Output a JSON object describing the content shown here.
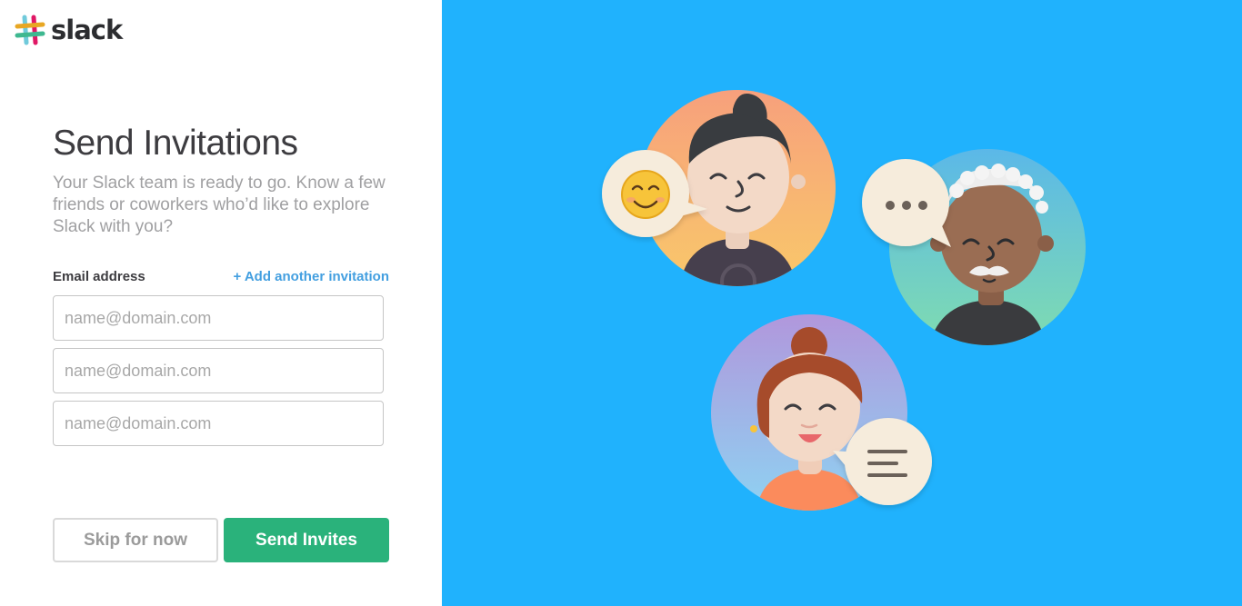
{
  "brand": {
    "name": "slack",
    "colors": {
      "green": "#2ab27b",
      "blue": "#439fe0",
      "panel": "#20b2fd"
    }
  },
  "form": {
    "title": "Send Invitations",
    "subtitle": "Your Slack team is ready to go. Know a few friends or coworkers who’d like to explore Slack with you?",
    "email_label": "Email address",
    "add_link": "+ Add another invitation",
    "inputs": [
      {
        "value": "",
        "placeholder": "name@domain.com"
      },
      {
        "value": "",
        "placeholder": "name@domain.com"
      },
      {
        "value": "",
        "placeholder": "name@domain.com"
      }
    ],
    "skip_label": "Skip for now",
    "send_label": "Send Invites"
  },
  "illustration": {
    "avatars": [
      "man-with-topknot",
      "elderly-man-with-mustache",
      "woman-with-bun"
    ],
    "bubbles": [
      "smile-emoji-icon",
      "ellipsis-icon",
      "text-lines-icon"
    ]
  }
}
